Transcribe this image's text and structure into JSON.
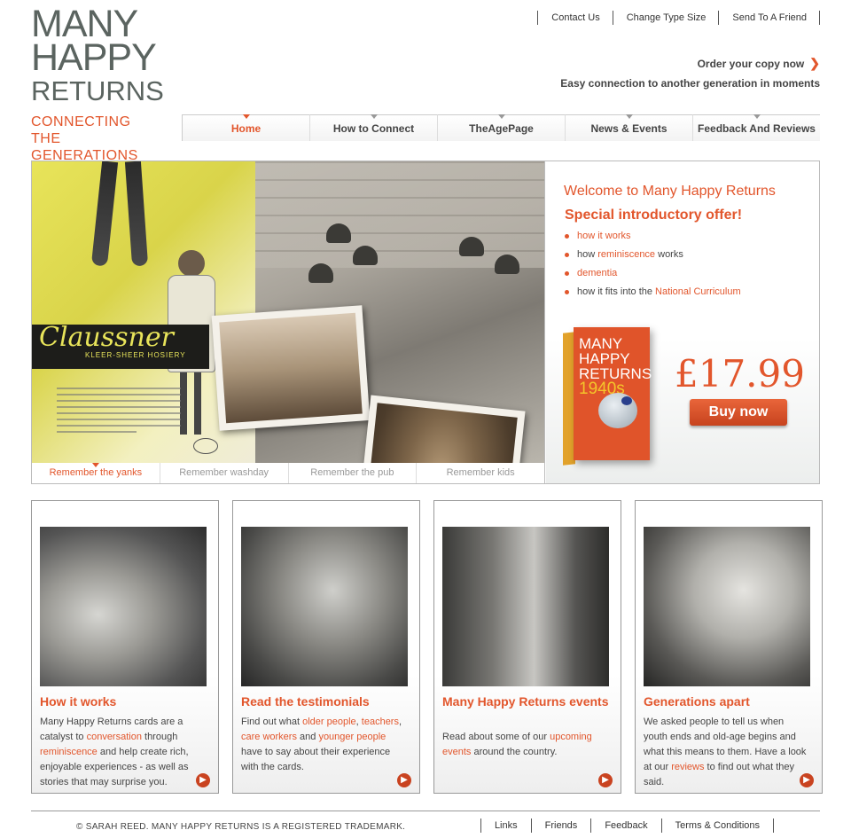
{
  "logo": {
    "line1": "MANY",
    "line2": "HAPPY",
    "line3": "RETURNS",
    "sub1": "CONNECTING THE",
    "sub2": "GENERATIONS"
  },
  "toplinks": [
    "Contact Us",
    "Change Type Size",
    "Send To A Friend"
  ],
  "order": {
    "label": "Order your copy now",
    "icon": "chevron-right-icon"
  },
  "tagline": "Easy connection to another generation in moments",
  "nav": [
    "Home",
    "How to Connect",
    "TheAgePage",
    "News & Events",
    "Feedback And Reviews"
  ],
  "hero": {
    "poster_brand": "Claussner",
    "poster_tag": "KLEER-SHEER HOSIERY",
    "tabs": [
      "Remember the yanks",
      "Remember washday",
      "Remember the pub",
      "Remember kids"
    ],
    "welcome": "Welcome to Many Happy Returns",
    "special": "Special introductory offer!",
    "bullets": [
      {
        "pre": "",
        "link": "how it works",
        "post": ""
      },
      {
        "pre": "how ",
        "link": "reminiscence",
        "post": " works"
      },
      {
        "pre": "",
        "link": "dementia",
        "post": ""
      },
      {
        "pre": "how it fits into the ",
        "link": "National Curriculum",
        "post": ""
      }
    ],
    "book": {
      "t1": "MANY",
      "t2": "HAPPY",
      "t3": "RETURNS",
      "year": "1940s"
    },
    "price": "£17.99",
    "buy": "Buy now"
  },
  "cards": [
    {
      "title": "How it works",
      "parts": [
        "Many Happy Returns cards are a catalyst to ",
        "conversation",
        " through ",
        "reminiscence",
        " and help create rich, enjoyable experiences - as well as stories that may surprise you."
      ]
    },
    {
      "title": "Read the testimonials",
      "parts": [
        "Find out what ",
        "older people",
        ", ",
        "teachers",
        ", ",
        "care workers",
        " and ",
        "younger people",
        " have to say about their experience with the cards."
      ]
    },
    {
      "title": "Many Happy Returns events",
      "parts": [
        "Read about some of our ",
        "upcoming events",
        " around the country."
      ]
    },
    {
      "title": "Generations apart",
      "parts": [
        "We asked people to tell us when youth ends and old-age begins and what this means to them. Have a look at our ",
        "reviews",
        " to find out what they said."
      ]
    }
  ],
  "footer": {
    "copyright": "© SARAH REED. MANY HAPPY RETURNS IS A REGISTERED TRADEMARK.",
    "links": [
      "Links",
      "Friends",
      "Feedback",
      "Terms & Conditions"
    ]
  },
  "colors": {
    "accent": "#e2562c",
    "logo_grey": "#5b6460"
  }
}
